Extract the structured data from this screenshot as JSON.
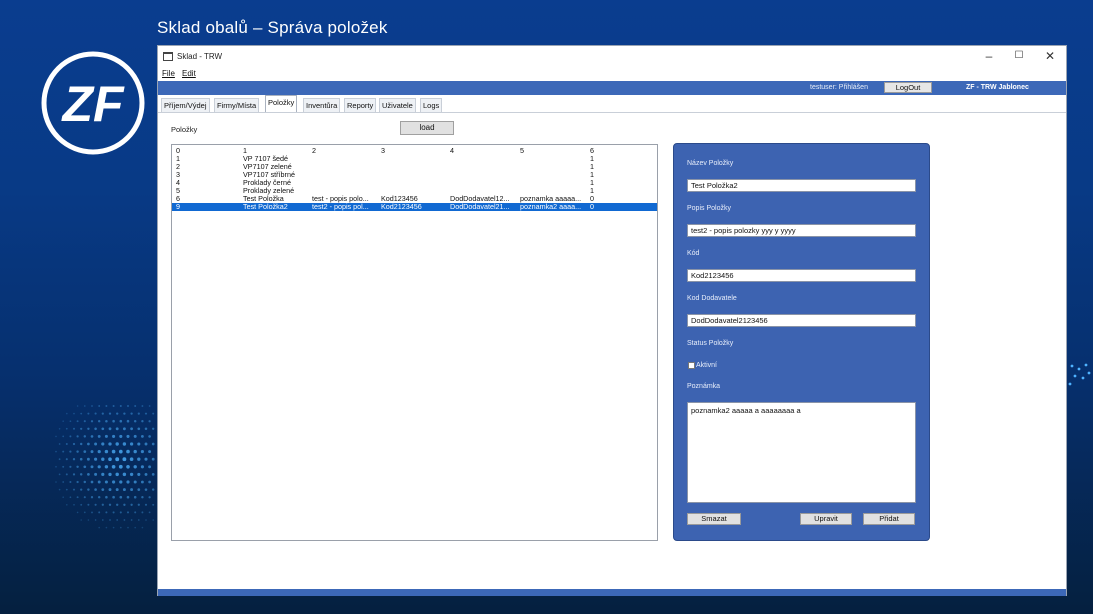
{
  "slide": {
    "title": "Sklad obalů – Správa položek",
    "logo_text": "ZF"
  },
  "window": {
    "title": "Sklad - TRW",
    "controls": {
      "minimize": "–",
      "maximize": "☐",
      "close": "✕"
    }
  },
  "menu": {
    "file": "File",
    "edit": "Edit"
  },
  "header": {
    "user_status": "testuser: Přihlášen",
    "logout_label": "LogOut",
    "company": "ZF - TRW Jablonec",
    "accent_color": "#3c68b8"
  },
  "tabs": [
    {
      "label": "Příjem/Výdej"
    },
    {
      "label": "Firmy/Místa"
    },
    {
      "label": "Položky",
      "active": true
    },
    {
      "label": "Inventůra"
    },
    {
      "label": "Reporty"
    },
    {
      "label": "Uživatele"
    },
    {
      "label": "Logs"
    }
  ],
  "list": {
    "label": "Položky",
    "load_label": "load",
    "columns": [
      "0",
      "1",
      "2",
      "3",
      "4",
      "5",
      "6"
    ],
    "rows": [
      [
        "1",
        "VP 7107 šedé",
        "",
        "",
        "",
        "",
        "1"
      ],
      [
        "2",
        "VP7107 zelené",
        "",
        "",
        "",
        "",
        "1"
      ],
      [
        "3",
        "VP7107 stříbrné",
        "",
        "",
        "",
        "",
        "1"
      ],
      [
        "4",
        "Proklady černé",
        "",
        "",
        "",
        "",
        "1"
      ],
      [
        "5",
        "Proklady zelené",
        "",
        "",
        "",
        "",
        "1"
      ],
      [
        "6",
        "Test Položka",
        "test - popis polo...",
        "Kod123456",
        "DodDodavatel12...",
        "poznamka aaaaa...",
        "0"
      ],
      [
        "9",
        "Test Položka2",
        "test2 - popis pol...",
        "Kod2123456",
        "DodDodavatel21...",
        "poznamka2 aaaa...",
        "0"
      ]
    ],
    "selected_row": 6,
    "selection_color": "#1169d2"
  },
  "detail": {
    "name_label": "Název Položky",
    "name_value": "Test Položka2",
    "desc_label": "Popis Položky",
    "desc_value": "test2 - popis polozky yyy y yyyy",
    "code_label": "Kód",
    "code_value": "Kod2123456",
    "supplier_label": "Kod Dodavatele",
    "supplier_value": "DodDodavatel2123456",
    "status_label": "Status Položky",
    "active_label": "Aktivní",
    "active_checked": false,
    "note_label": "Poznámka",
    "note_value": "poznamka2 aaaaa a aaaaaaaa a",
    "delete_label": "Smazat",
    "edit_label": "Upravit",
    "add_label": "Přidat",
    "panel_color": "#3d63b1"
  }
}
